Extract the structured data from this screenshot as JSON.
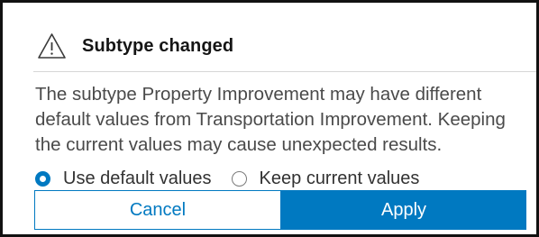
{
  "dialog": {
    "icon": "warning-triangle-icon",
    "title": "Subtype changed",
    "message": "The subtype Property Improvement may have different default values from Transportation Improvement. Keeping the current values may cause unexpected results.",
    "options": [
      {
        "label": "Use default values",
        "selected": true
      },
      {
        "label": "Keep current values",
        "selected": false
      }
    ],
    "buttons": {
      "cancel_label": "Cancel",
      "apply_label": "Apply"
    },
    "colors": {
      "accent": "#0079c1",
      "frame": "#111111",
      "text": "#4a4a4a"
    }
  }
}
